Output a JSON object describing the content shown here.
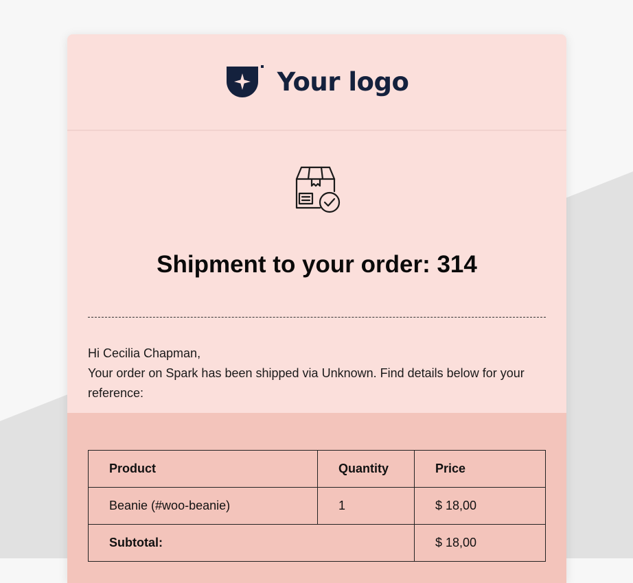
{
  "logo": {
    "text": "Your logo",
    "icon": "shield-star-logo-icon",
    "color": "#14213d"
  },
  "hero": {
    "icon": "package-shipped-icon",
    "title": "Shipment to your order: 314"
  },
  "greeting": {
    "line1": "Hi Cecilia Chapman,",
    "line2": "Your order on Spark has been shipped via Unknown. Find details below for your reference:"
  },
  "table": {
    "headers": {
      "product": "Product",
      "quantity": "Quantity",
      "price": "Price"
    },
    "rows": [
      {
        "product": "Beanie (#woo-beanie)",
        "quantity": "1",
        "price": "$ 18,00"
      }
    ],
    "subtotal": {
      "label": "Subtotal:",
      "value": "$ 18,00"
    }
  },
  "colors": {
    "page_bg": "#f7f7f7",
    "card_bg": "#fbdfdb",
    "table_section_bg": "#f3c4bb",
    "text": "#0a0a0a"
  }
}
